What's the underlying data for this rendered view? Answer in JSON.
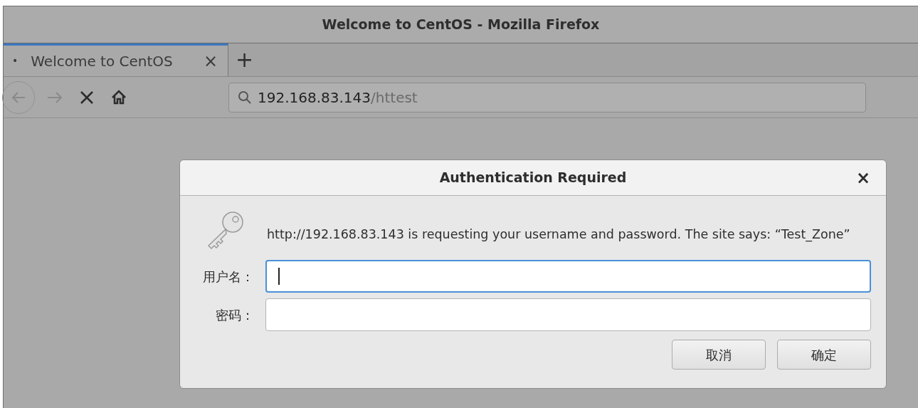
{
  "window": {
    "title": "Welcome to CentOS - Mozilla Firefox"
  },
  "tabs": [
    {
      "label": "Welcome to CentOS",
      "selected": true,
      "dot": "•",
      "close": "×"
    }
  ],
  "new_tab": "+",
  "url": {
    "host": "192.168.83.143",
    "path": "/httest"
  },
  "dialog": {
    "title": "Authentication Required",
    "close": "×",
    "message": "http://192.168.83.143 is requesting your username and password. The site says: “Test_Zone”",
    "fields": [
      {
        "label": "用户名：",
        "focused": true
      },
      {
        "label": "密码：",
        "focused": false
      }
    ],
    "buttons": [
      "取消",
      "确定"
    ]
  }
}
